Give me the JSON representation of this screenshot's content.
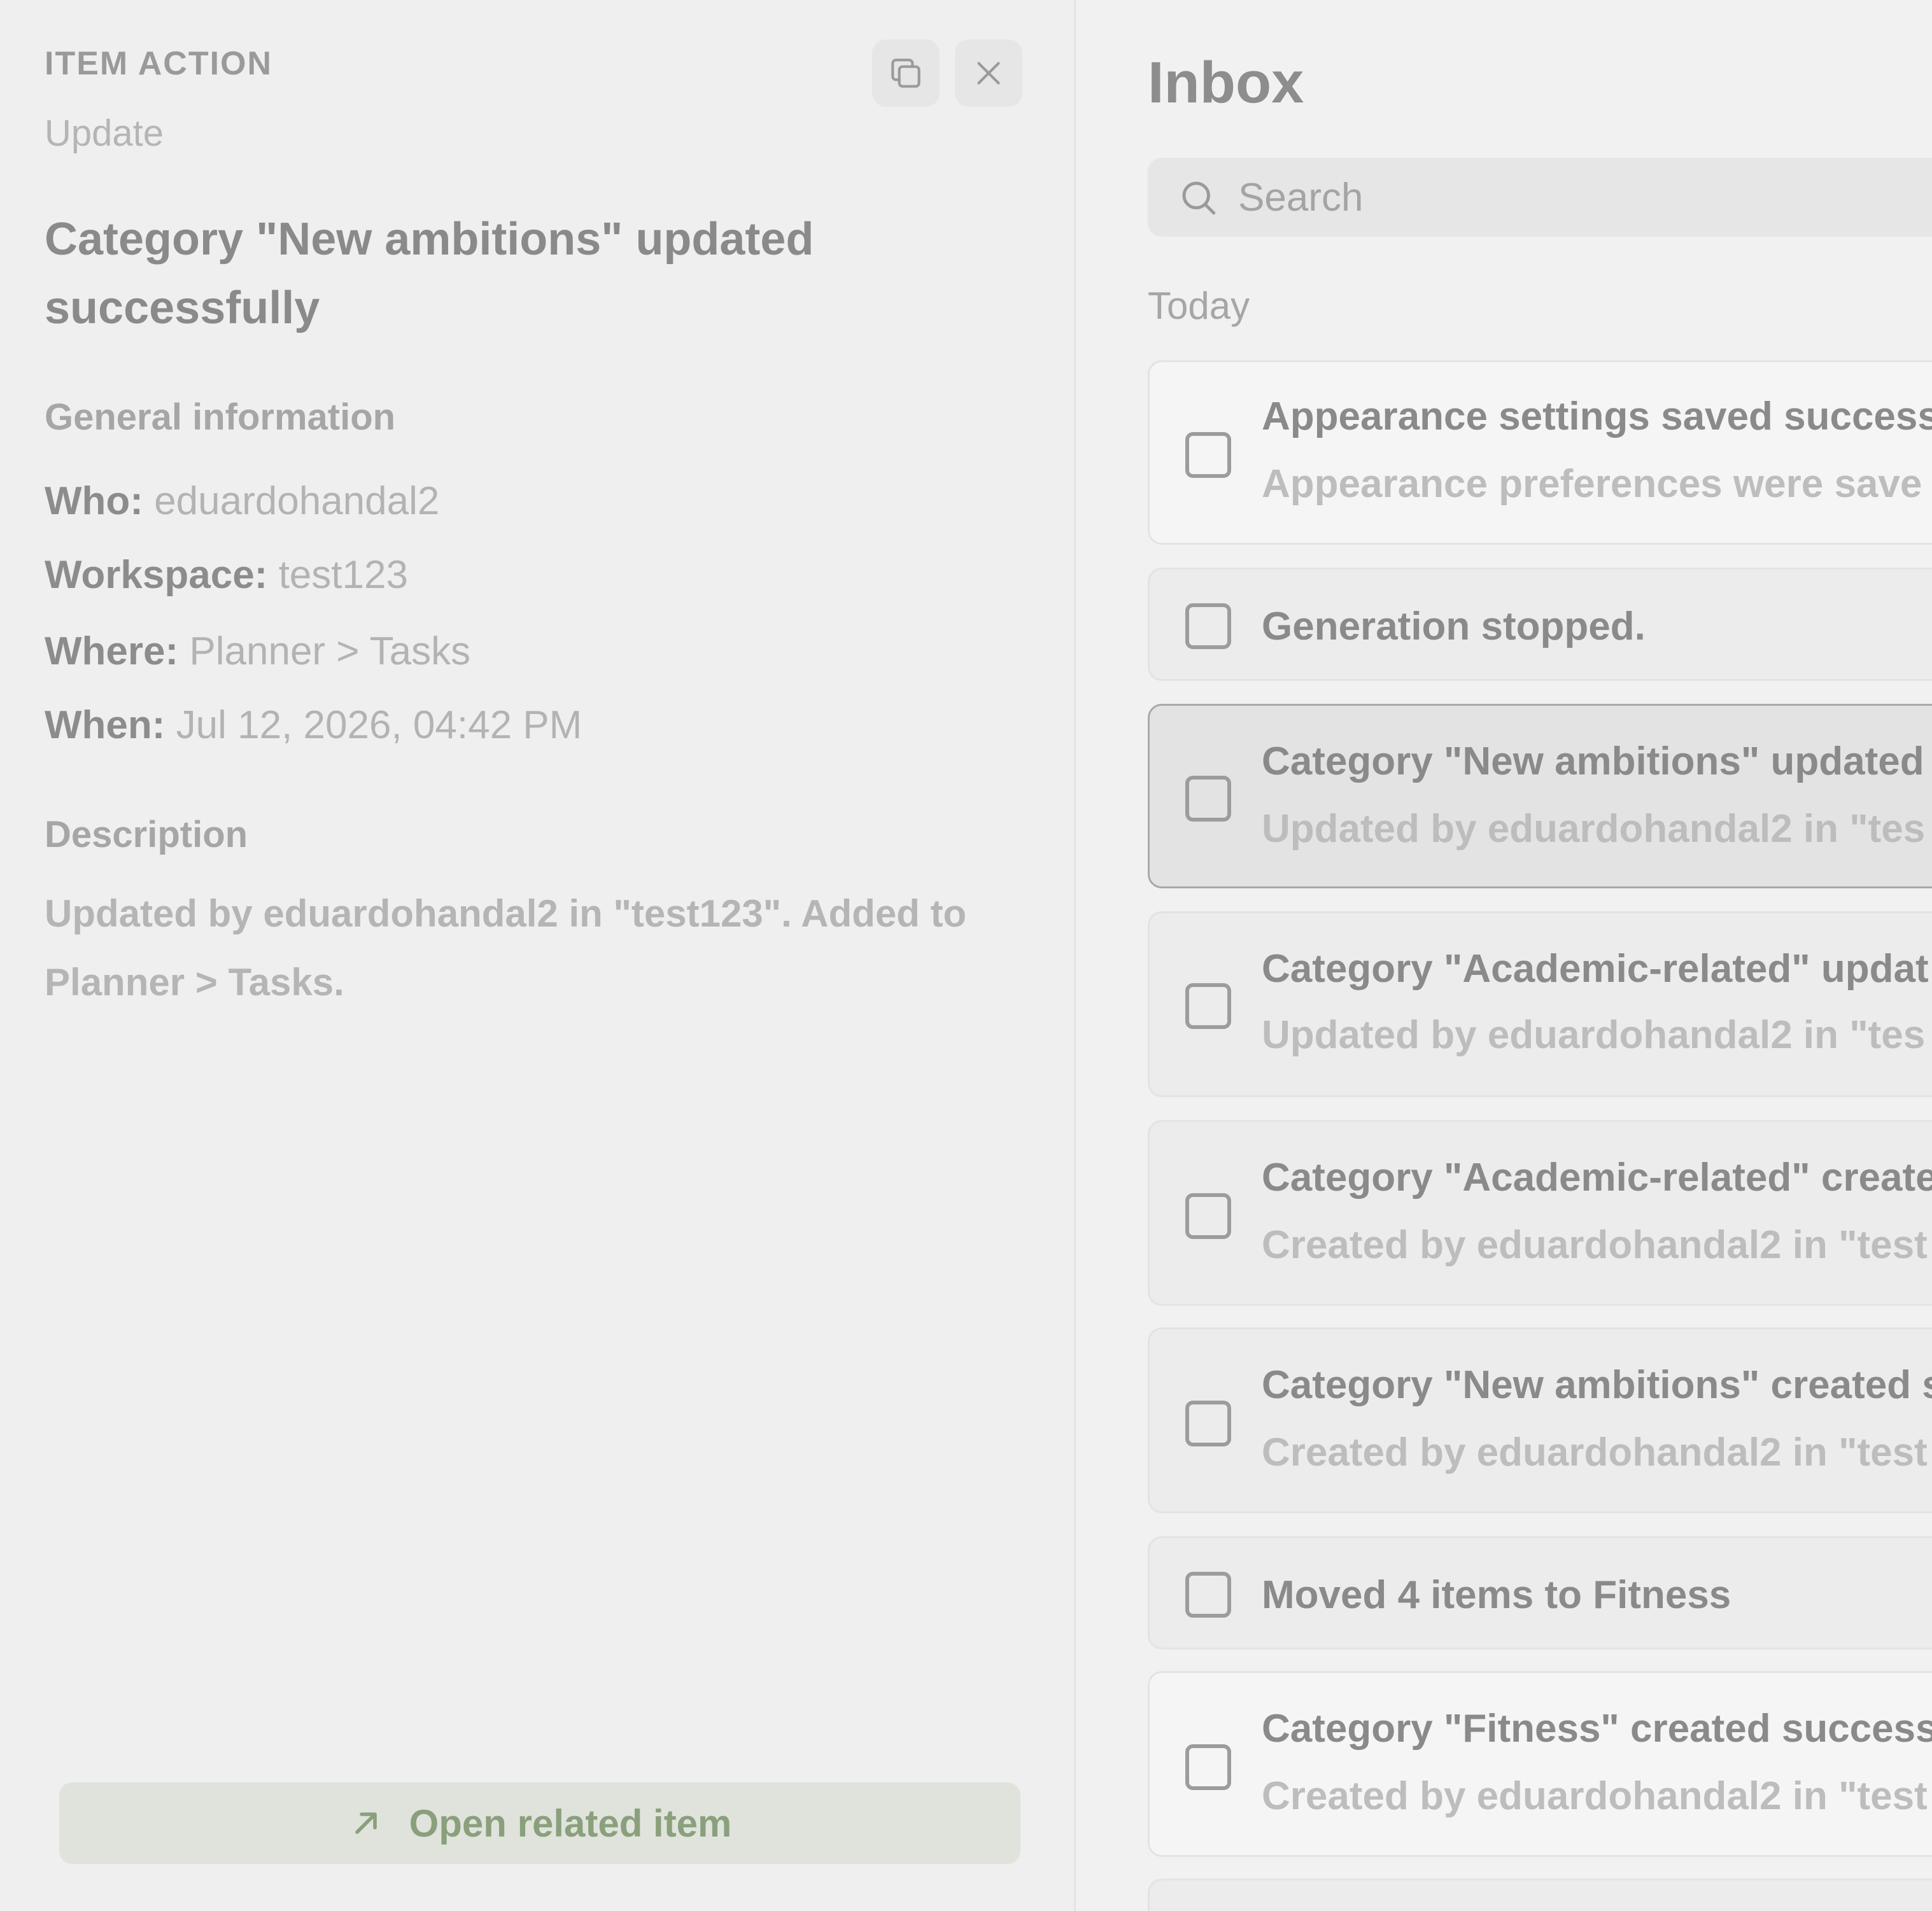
{
  "detail": {
    "eyebrow": "ITEM ACTION",
    "subtype": "Update",
    "title": "Category \"New ambitions\" updated successfully",
    "general_label": "General information",
    "who_key": "Who:",
    "who_value": "eduardohandal2",
    "workspace_key": "Workspace:",
    "workspace_value": "test123",
    "where_key": "Where:",
    "where_value": "Planner > Tasks",
    "when_key": "When:",
    "when_value": "Jul 12, 2026, 04:42 PM",
    "description_label": "Description",
    "description": "Updated by eduardohandal2 in \"test123\". Added to Planner > Tasks.",
    "open_related_label": "Open related item"
  },
  "icons": {
    "copy": "copy-icon",
    "close": "close-icon",
    "search": "search-icon",
    "open_related": "arrow-up-right-icon"
  },
  "inbox": {
    "title": "Inbox",
    "search_placeholder": "Search",
    "group_today": "Today",
    "items": [
      {
        "title": "Appearance settings saved success",
        "subtitle": "Appearance preferences were save"
      },
      {
        "title": "Generation stopped.",
        "subtitle": ""
      },
      {
        "title": "Category \"New ambitions\" updated",
        "subtitle": "Updated by eduardohandal2 in \"tes"
      },
      {
        "title": "Category \"Academic-related\" updat",
        "subtitle": "Updated by eduardohandal2 in \"tes"
      },
      {
        "title": "Category \"Academic-related\" create",
        "subtitle": "Created by eduardohandal2 in \"test"
      },
      {
        "title": "Category \"New ambitions\" created s",
        "subtitle": "Created by eduardohandal2 in \"test"
      },
      {
        "title": "Moved 4 items to Fitness",
        "subtitle": ""
      },
      {
        "title": "Category \"Fitness\" created success",
        "subtitle": "Created by eduardohandal2 in \"test"
      }
    ]
  },
  "colors": {
    "accent_green": "#8aa07c",
    "selected_border": "#a9a9a9"
  }
}
